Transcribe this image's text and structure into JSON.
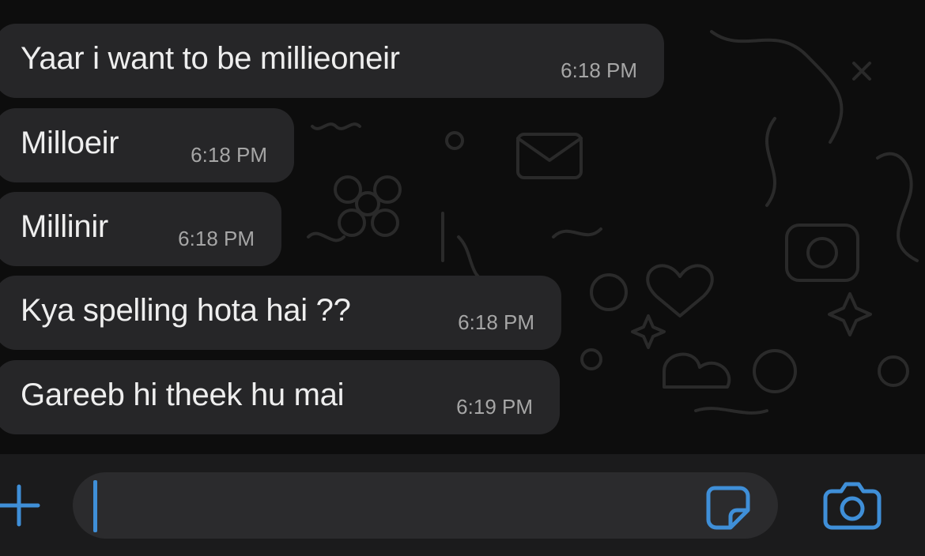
{
  "conversation": {
    "messages": [
      {
        "text": "Yaar i want to be millieoneir",
        "time": "6:18 PM"
      },
      {
        "text": "Milloeir",
        "time": "6:18 PM"
      },
      {
        "text": "Millinir",
        "time": "6:18 PM"
      },
      {
        "text": "Kya spelling hota hai ??",
        "time": "6:18 PM"
      },
      {
        "text": "Gareeb hi theek hu mai",
        "time": "6:19 PM"
      }
    ]
  },
  "composer": {
    "value": "",
    "icons": {
      "attach": "plus-icon",
      "sticker": "sticker-icon",
      "camera": "camera-icon"
    },
    "accent_color": "#3f8fd8"
  },
  "theme": {
    "background": "#0d0d0d",
    "bubble_color": "#262628",
    "message_text_color": "#eeeeee",
    "timestamp_color": "#a6a6a6"
  }
}
